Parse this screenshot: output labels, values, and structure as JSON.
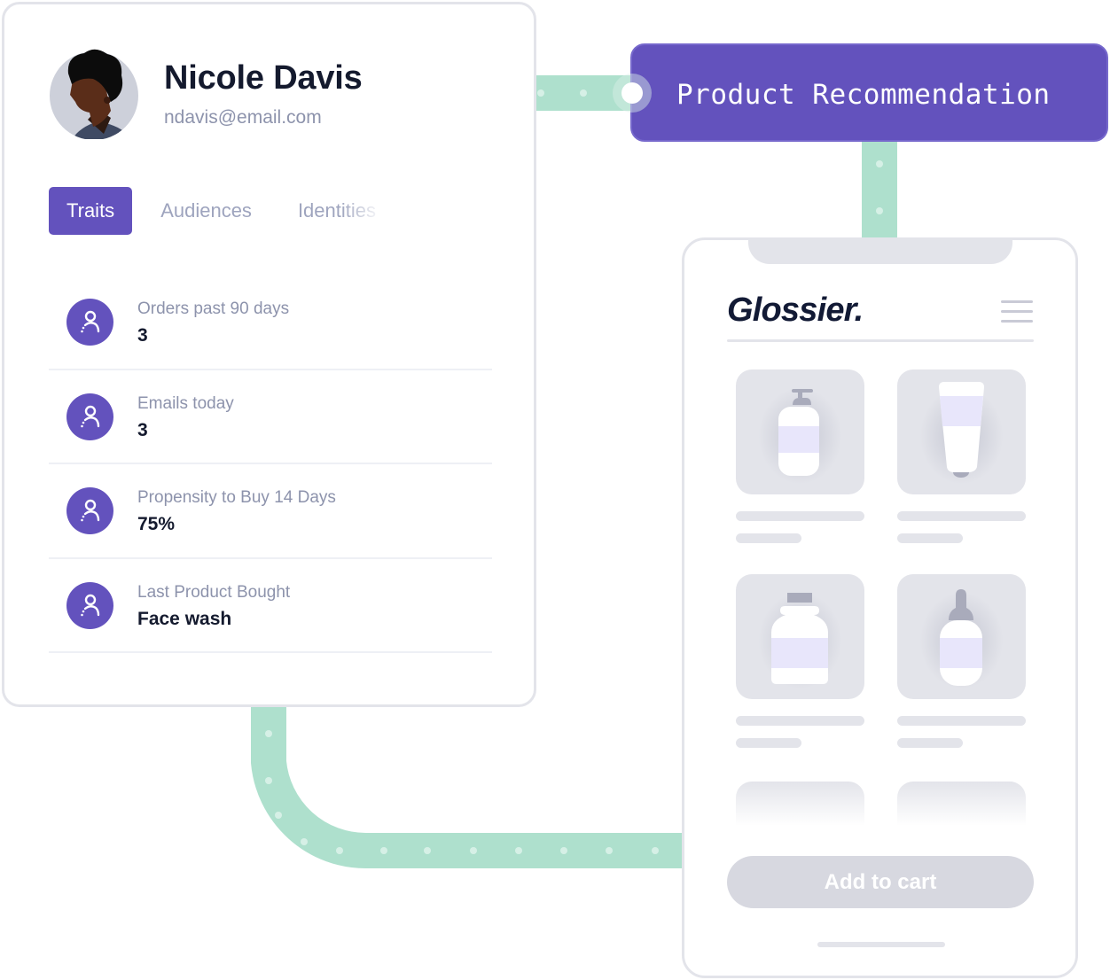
{
  "profile": {
    "name": "Nicole Davis",
    "email": "ndavis@email.com",
    "avatar_icon": "person-avatar-illustration",
    "tabs": [
      {
        "label": "Traits",
        "active": true
      },
      {
        "label": "Audiences",
        "active": false
      },
      {
        "label": "Identities",
        "active": false
      }
    ],
    "traits": [
      {
        "label": "Orders past 90 days",
        "value": "3",
        "icon": "user-icon"
      },
      {
        "label": "Emails today",
        "value": "3",
        "icon": "user-icon"
      },
      {
        "label": "Propensity to Buy 14 Days",
        "value": "75%",
        "icon": "user-icon"
      },
      {
        "label": "Last Product Bought",
        "value": "Face wash",
        "icon": "user-icon"
      }
    ]
  },
  "recommendation_node": {
    "title": "Product Recommendation"
  },
  "phone": {
    "brand": "Glossier.",
    "menu_icon": "hamburger-menu-icon",
    "products": [
      {
        "icon": "pump-bottle-icon"
      },
      {
        "icon": "tube-icon"
      },
      {
        "icon": "jar-bottle-icon"
      },
      {
        "icon": "dropper-bottle-icon"
      }
    ],
    "cart_button": "Add to cart"
  },
  "colors": {
    "accent": "#6352bd",
    "connector": "#aee0cd",
    "text_dark": "#141a2e",
    "text_muted": "#8d93ac",
    "skeleton": "#e3e4ea"
  }
}
